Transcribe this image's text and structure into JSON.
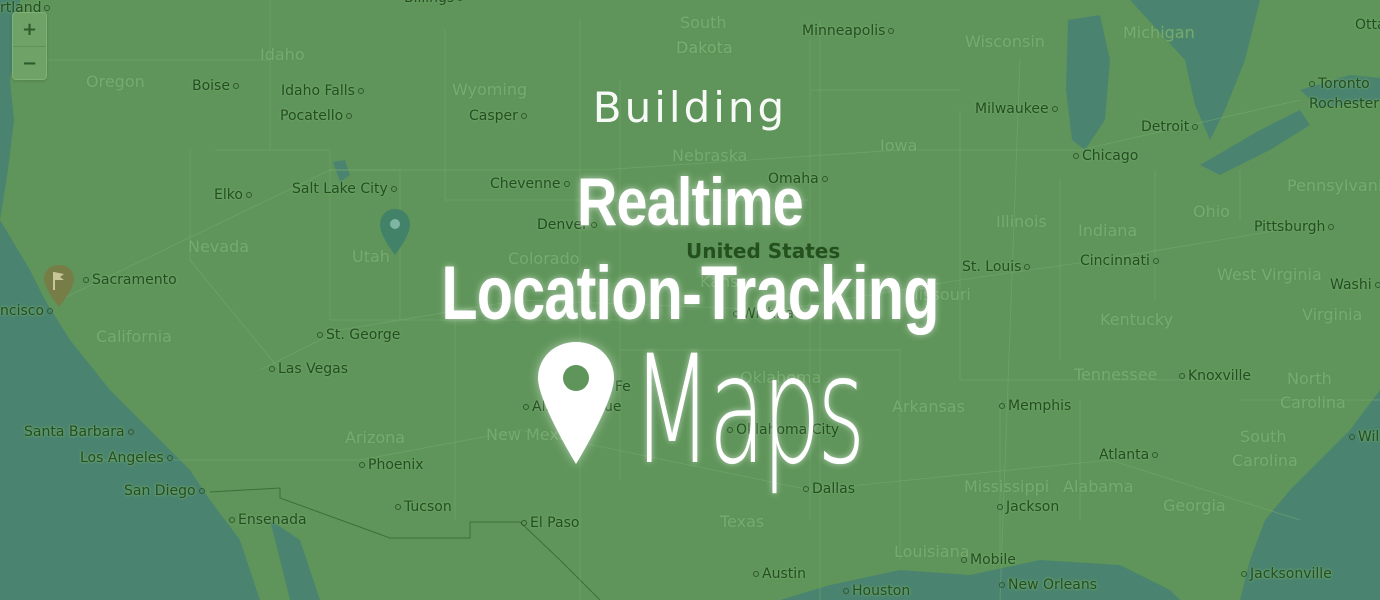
{
  "title": {
    "line1": "Building",
    "line2": "Realtime",
    "line3": "Location-Tracking",
    "line4": "Maps",
    "pin_icon": "map-pin-icon"
  },
  "zoom_controls": {
    "zoom_in": "+",
    "zoom_out": "−"
  },
  "markers": [
    {
      "name": "flag-marker",
      "icon": "flag-icon",
      "color": "#7a7a45"
    },
    {
      "name": "location-marker",
      "icon": "map-pin-icon",
      "color": "#3e7f6a"
    }
  ],
  "map": {
    "country": "United States",
    "states": [
      "Oregon",
      "Idaho",
      "Wyoming",
      "South",
      "Dakota",
      "Nebraska",
      "Iowa",
      "Wisconsin",
      "Michigan",
      "Nevada",
      "Utah",
      "Colorado",
      "Kansas",
      "Missouri",
      "Illinois",
      "Indiana",
      "Ohio",
      "Pennsylvania",
      "West Virginia",
      "Virginia",
      "Kentucky",
      "Tennessee",
      "North",
      "Carolina",
      "South",
      "Carolina",
      "California",
      "Arizona",
      "New Mexico",
      "Oklahoma",
      "Arkansas",
      "Texas",
      "Louisiana",
      "Mississippi",
      "Alabama",
      "Georgia"
    ],
    "cities": [
      "Portland",
      "Boise",
      "Idaho Falls",
      "Pocatello",
      "Casper",
      "Billings",
      "Minneapolis",
      "Milwaukee",
      "Chicago",
      "Detroit",
      "Toronto",
      "Rochester",
      "Ottawa",
      "Cheyenne",
      "Denver",
      "Omaha",
      "Elko",
      "Salt Lake City",
      "Sacramento",
      "San Francisco",
      "St. George",
      "Las Vegas",
      "Santa Barbara",
      "Los Angeles",
      "San Diego",
      "Ensenada",
      "Phoenix",
      "Tucson",
      "El Paso",
      "Albuquerque",
      "Santa Fe",
      "Wichita",
      "Oklahoma City",
      "Dallas",
      "Austin",
      "Houston",
      "St. Louis",
      "Cincinnati",
      "Pittsburgh",
      "Washington",
      "Memphis",
      "Knoxville",
      "Atlanta",
      "Jackson",
      "Mobile",
      "New Orleans",
      "Jacksonville",
      "Wilmington"
    ]
  },
  "colors": {
    "land": "#5f955a",
    "water": "#4a8470",
    "overlay_text": "#ffffff",
    "city_text": "#254d22",
    "state_text": "#7aad73"
  }
}
